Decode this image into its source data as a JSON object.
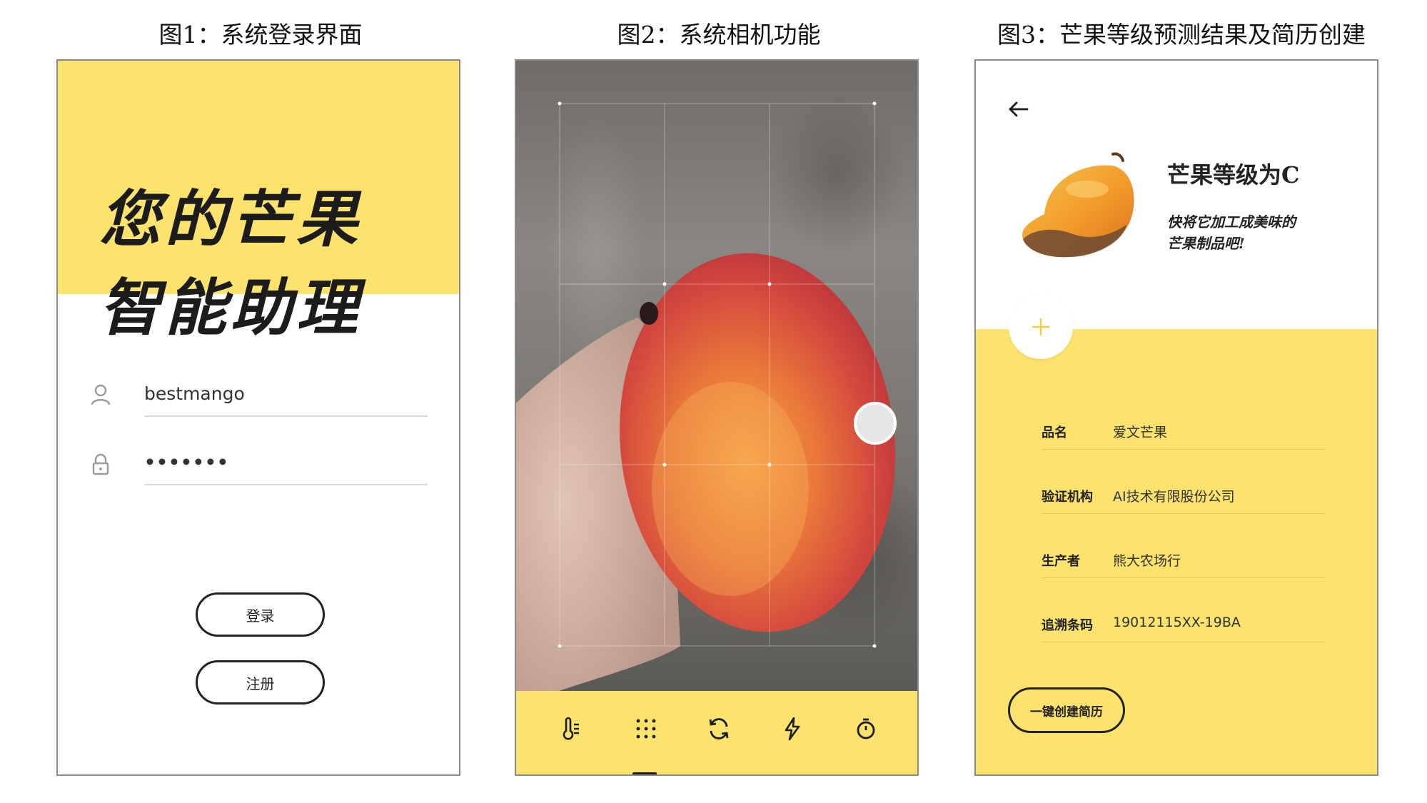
{
  "captions": {
    "fig1": "图1：系统登录界面",
    "fig2": "图2：系统相机功能",
    "fig3": "图3：芒果等级预测结果及简历创建"
  },
  "login": {
    "slogan_line1": "您的芒果",
    "slogan_line2": "智能助理",
    "username_value": "bestmango",
    "password_value": "•••••••",
    "login_button": "登录",
    "register_button": "注册",
    "icons": [
      "user-icon",
      "lock-icon"
    ],
    "accent_color": "#fbe36d"
  },
  "camera": {
    "toolbar_icons": [
      "thermometer-icon",
      "grid-icon",
      "switch-camera-icon",
      "flash-icon",
      "timer-icon"
    ],
    "accent_color": "#fbe36d"
  },
  "result": {
    "grade_title": "芒果等级为C",
    "subtitle_line1": "快将它加工成美味的",
    "subtitle_line2": "芒果制品吧!",
    "fields": [
      {
        "label": "品名",
        "value": "爱文芒果"
      },
      {
        "label": "验证机构",
        "value": "AI技术有限股份公司"
      },
      {
        "label": "生产者",
        "value": "熊大农场行"
      },
      {
        "label": "追溯条码",
        "value": "19012115XX-19BA"
      }
    ],
    "create_resume_button": "一键创建简历",
    "icons": [
      "back-arrow-icon",
      "mango-icon",
      "plus-icon"
    ],
    "accent_color": "#fbe36d"
  }
}
